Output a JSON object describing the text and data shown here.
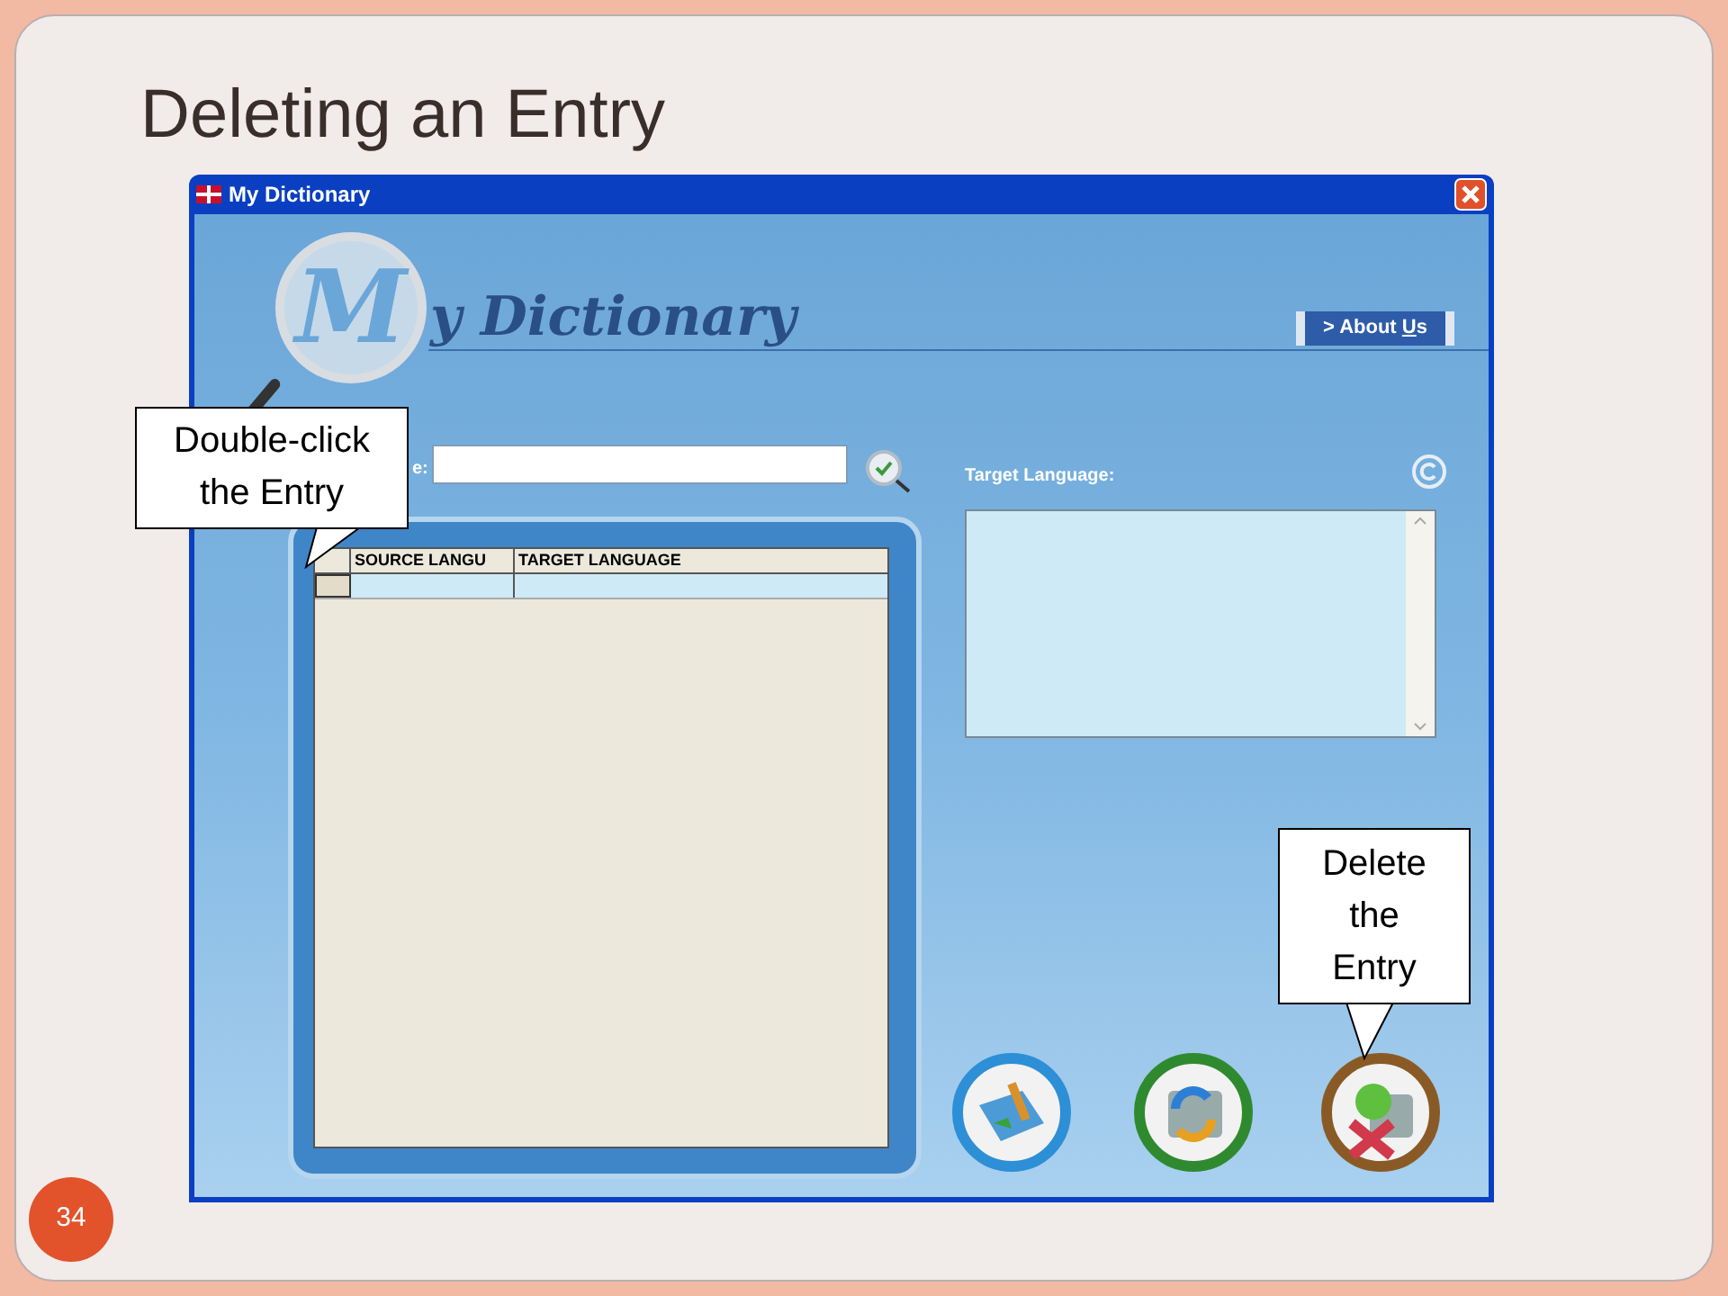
{
  "slide": {
    "title": "Deleting an Entry",
    "number": "34"
  },
  "window": {
    "title": "My Dictionary",
    "logo": {
      "initial": "M",
      "text": "y Dictionary"
    },
    "about_link": {
      "prefix": "> About ",
      "underlined": "U",
      "rest": "s"
    }
  },
  "search": {
    "label": "e:"
  },
  "grid": {
    "columns": [
      {
        "label": "SOURCE LANGU"
      },
      {
        "label": "TARGET LANGUAGE"
      }
    ],
    "rows": [
      {
        "selected": true
      }
    ]
  },
  "target": {
    "label": "Target Language:"
  },
  "actions": [
    {
      "kind": "add"
    },
    {
      "kind": "edit"
    },
    {
      "kind": "delete"
    }
  ],
  "callouts": [
    {
      "kind": "left",
      "text": "Double-click the Entry"
    },
    {
      "kind": "right",
      "text": "Delete the Entry"
    }
  ]
}
